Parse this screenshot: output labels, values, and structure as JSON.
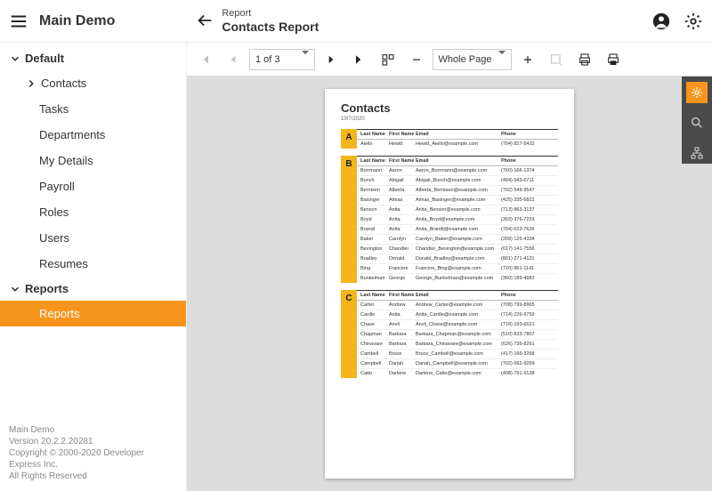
{
  "header": {
    "app_title": "Main Demo",
    "breadcrumb_small": "Report",
    "breadcrumb_big": "Contacts Report"
  },
  "sidebar": {
    "group_default": "Default",
    "items_default": [
      {
        "label": "Contacts",
        "has_sub": true
      },
      {
        "label": "Tasks"
      },
      {
        "label": "Departments"
      },
      {
        "label": "My Details"
      },
      {
        "label": "Payroll"
      },
      {
        "label": "Roles"
      },
      {
        "label": "Users"
      },
      {
        "label": "Resumes"
      }
    ],
    "group_reports": "Reports",
    "reports_item": "Reports"
  },
  "footer": {
    "l1": "Main Demo",
    "l2": "Version 20.2.2.20281",
    "l3": "Copyright © 2000-2020 Developer Express Inc.",
    "l4": "All Rights Reserved"
  },
  "viewer": {
    "page_indicator": "1 of 3",
    "zoom_label": "Whole Page"
  },
  "report": {
    "title": "Contacts",
    "date": "10/7/2020",
    "cols": {
      "last": "Last Name",
      "first": "First Name",
      "email": "Email",
      "phone": "Phone"
    },
    "sections": [
      {
        "letter": "A",
        "rows": [
          {
            "last": "Aiello",
            "first": "Hewitt",
            "email": "Hewitt_Aiello@example.com",
            "phone": "(704) 827-5432"
          }
        ]
      },
      {
        "letter": "B",
        "rows": [
          {
            "last": "Borrmann",
            "first": "Aaron",
            "email": "Aaron_Borrmann@example.com",
            "phone": "(760) 166-1374"
          },
          {
            "last": "Bunch",
            "first": "Abigail",
            "email": "Abigail_Bunch@example.com",
            "phone": "(404) 943-6711"
          },
          {
            "last": "Berntsen",
            "first": "Alberta",
            "email": "Alberta_Berntsen@example.com",
            "phone": "(702) 549-9547"
          },
          {
            "last": "Basinger",
            "first": "Almas",
            "email": "Almas_Basinger@example.com",
            "phone": "(425) 335-6822"
          },
          {
            "last": "Benson",
            "first": "Anita",
            "email": "Anita_Benson@example.com",
            "phone": "(713) 863-3137"
          },
          {
            "last": "Boyd",
            "first": "Anita",
            "email": "Anita_Boyd@example.com",
            "phone": "(303) 376-7233"
          },
          {
            "last": "Brandt",
            "first": "Anita",
            "email": "Anita_Brandt@example.com",
            "phone": "(704) 622-7626"
          },
          {
            "last": "Baker",
            "first": "Carolyn",
            "email": "Carolyn_Baker@example.com",
            "phone": "(209) 125-4334"
          },
          {
            "last": "Bevington",
            "first": "Chandler",
            "email": "Chandler_Bevington@example.com",
            "phone": "(617) 141-7556"
          },
          {
            "last": "Bradley",
            "first": "Donald",
            "email": "Donald_Bradley@example.com",
            "phone": "(801) 271-4121"
          },
          {
            "last": "Bing",
            "first": "Francine",
            "email": "Francine_Bing@example.com",
            "phone": "(720) 861-1141"
          },
          {
            "last": "Bunkelman",
            "first": "George",
            "email": "George_Bunkelman@example.com",
            "phone": "(360) 189-4982"
          }
        ]
      },
      {
        "letter": "C",
        "rows": [
          {
            "last": "Carter",
            "first": "Andrew",
            "email": "Andrew_Carter@example.com",
            "phone": "(708) 799-8965"
          },
          {
            "last": "Cardle",
            "first": "Anita",
            "email": "Anita_Cardle@example.com",
            "phone": "(714) 226-9759"
          },
          {
            "last": "Chase",
            "first": "Anvil",
            "email": "Anvil_Chase@example.com",
            "phone": "(718) 193-6621"
          },
          {
            "last": "Chapman",
            "first": "Barbara",
            "email": "Barbara_Chapman@example.com",
            "phone": "(510) 833-7807"
          },
          {
            "last": "Chinavare",
            "first": "Barbara",
            "email": "Barbara_Chinavare@example.com",
            "phone": "(626) 736-8261"
          },
          {
            "last": "Cambell",
            "first": "Bruce",
            "email": "Bruce_Cambell@example.com",
            "phone": "(417) 166-3268"
          },
          {
            "last": "Campbell",
            "first": "Dariah",
            "email": "Dariah_Campbell@example.com",
            "phone": "(702) 662-9269"
          },
          {
            "last": "Catto",
            "first": "Darlene",
            "email": "Darlene_Catto@example.com",
            "phone": "(408) 791-9138"
          }
        ]
      }
    ]
  }
}
